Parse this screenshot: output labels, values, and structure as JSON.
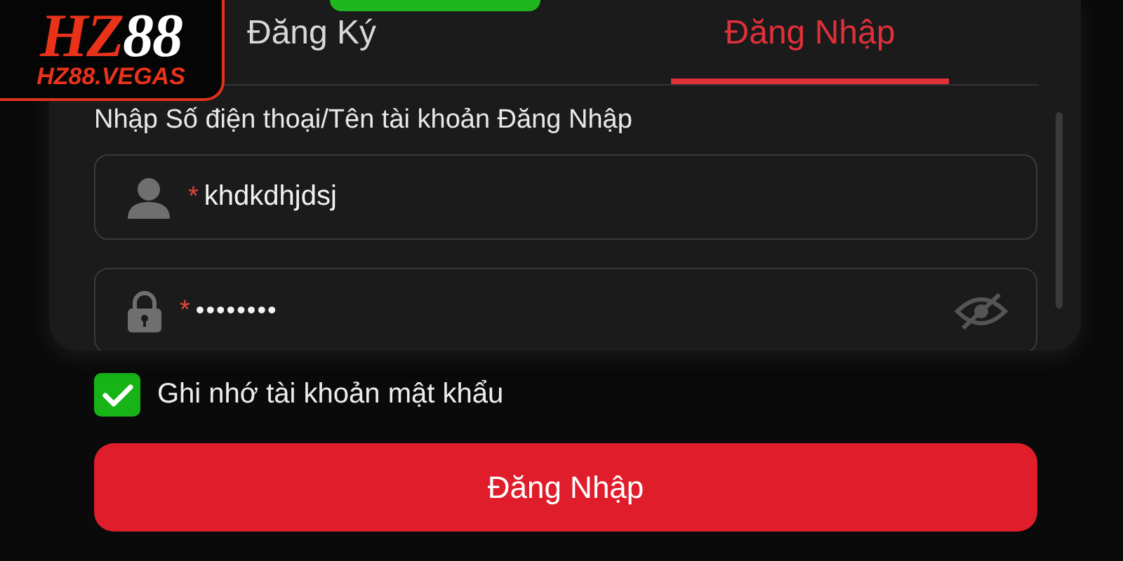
{
  "logo": {
    "brand_part_1": "HZ",
    "brand_part_2": "88",
    "domain": "HZ88.VEGAS"
  },
  "tabs": [
    {
      "label": "Đăng Ký",
      "selected": false
    },
    {
      "label": "Đăng Nhập",
      "selected": true
    }
  ],
  "form": {
    "label": "Nhập Số điện thoại/Tên tài khoản Đăng Nhập",
    "fields": [
      {
        "kind": "text",
        "required_mark": "*",
        "value": "khdkdhjdsj"
      },
      {
        "kind": "password",
        "required_mark": "*",
        "value": "••••••••"
      }
    ]
  },
  "remember": {
    "label": "Ghi nhớ tài khoản mật khẩu",
    "checked": true
  },
  "submit_button": "Đăng Nhập"
}
